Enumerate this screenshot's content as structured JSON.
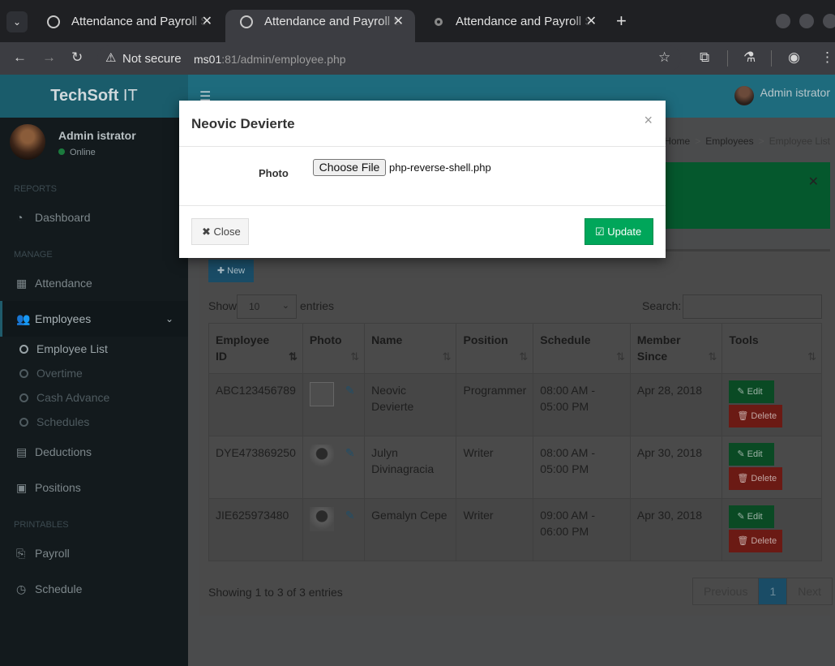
{
  "browser": {
    "tabs": [
      {
        "title": "Attendance and Payroll System"
      },
      {
        "title": "Attendance and Payroll System"
      },
      {
        "title": "Attendance and Payroll System"
      }
    ],
    "not_secure": "Not secure",
    "url_host": "ms01",
    "url_rest": ":81/admin/employee.php"
  },
  "app": {
    "logo_bold": "TechSoft",
    "logo_light": " IT",
    "top_user": "Admin istrator"
  },
  "sidebar": {
    "user_name": "Admin istrator",
    "status": "Online",
    "headers": {
      "reports": "REPORTS",
      "manage": "MANAGE",
      "printables": "PRINTABLES"
    },
    "items": {
      "dashboard": "Dashboard",
      "attendance": "Attendance",
      "employees": "Employees",
      "employee_list": "Employee List",
      "overtime": "Overtime",
      "cash_advance": "Cash Advance",
      "schedules": "Schedules",
      "deductions": "Deductions",
      "positions": "Positions",
      "payroll": "Payroll",
      "schedule": "Schedule"
    }
  },
  "breadcrumb": {
    "home": "Home",
    "section": "Employees",
    "current": "Employee List"
  },
  "box": {
    "new_label": "New",
    "show_label": "Show",
    "show_value": "10",
    "entries_label": "entries",
    "search_label": "Search:",
    "showing": "Showing 1 to 3 of 3 entries",
    "pager": {
      "previous": "Previous",
      "current": "1",
      "next": "Next"
    }
  },
  "table": {
    "headers": {
      "employee_id_1": "Employee",
      "employee_id_2": "ID",
      "photo": "Photo",
      "name": "Name",
      "position": "Position",
      "schedule": "Schedule",
      "member_since_1": "Member",
      "member_since_2": "Since",
      "tools": "Tools"
    },
    "edit_label": "Edit",
    "delete_label": "Delete",
    "rows": [
      {
        "id": "ABC123456789",
        "name": "Neovic Devierte",
        "position": "Programmer",
        "schedule": "08:00 AM - 05:00 PM",
        "since": "Apr 28, 2018"
      },
      {
        "id": "DYE473869250",
        "name": "Julyn Divinagracia",
        "position": "Writer",
        "schedule": "08:00 AM - 05:00 PM",
        "since": "Apr 30, 2018"
      },
      {
        "id": "JIE625973480",
        "name": "Gemalyn Cepe",
        "position": "Writer",
        "schedule": "09:00 AM - 06:00 PM",
        "since": "Apr 30, 2018"
      }
    ]
  },
  "modal": {
    "title": "Neovic Devierte",
    "close_x": "×",
    "photo_label": "Photo",
    "choose_file": "Choose File",
    "file_name": "php-reverse-shell.php",
    "close_label": "Close",
    "update_label": "Update"
  }
}
